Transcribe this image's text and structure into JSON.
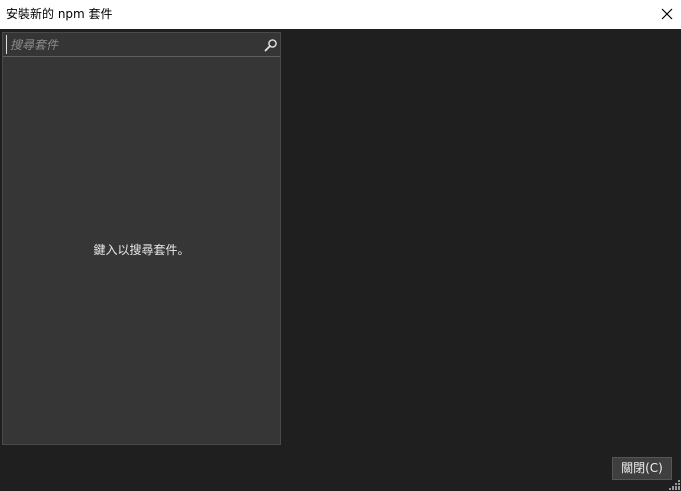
{
  "window": {
    "title": "安裝新的 npm 套件"
  },
  "titlebar": {
    "close_icon": "close-icon"
  },
  "search": {
    "placeholder": "搜尋套件",
    "value": "",
    "icon": "search-icon"
  },
  "results": {
    "empty_message": "鍵入以搜尋套件。"
  },
  "footer": {
    "close_label": "關閉(C)"
  },
  "colors": {
    "background": "#1f1f1f",
    "panel": "#363636",
    "titlebar": "#ffffff",
    "button": "#3f3f3f"
  }
}
